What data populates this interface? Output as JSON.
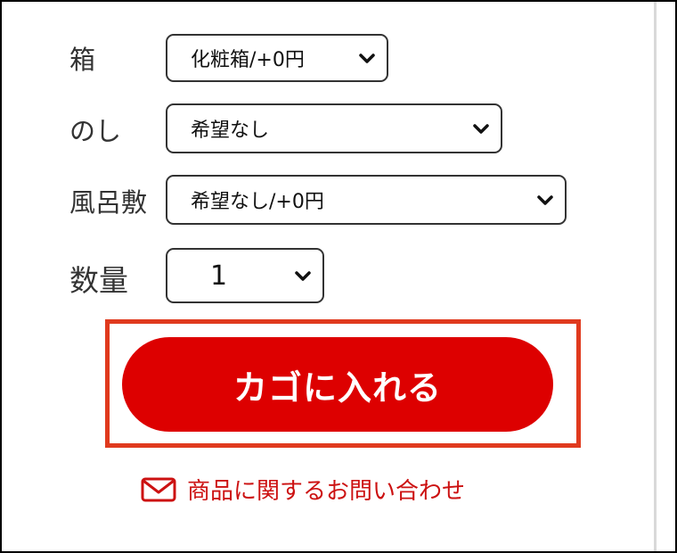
{
  "form": {
    "box": {
      "label": "箱",
      "selected": "化粧箱/+0円"
    },
    "noshi": {
      "label": "のし",
      "selected": "希望なし"
    },
    "furoshiki": {
      "label": "風呂敷",
      "selected": "希望なし/+0円"
    },
    "quantity": {
      "label": "数量",
      "selected": "1"
    }
  },
  "cart_button": {
    "label": "カゴに入れる"
  },
  "inquiry_link": {
    "label": "商品に関するお問い合わせ",
    "icon": "mail-icon"
  },
  "colors": {
    "accent_red": "#dd0000",
    "highlight_border": "#e03a1e",
    "inquiry_text": "#cc1111"
  }
}
